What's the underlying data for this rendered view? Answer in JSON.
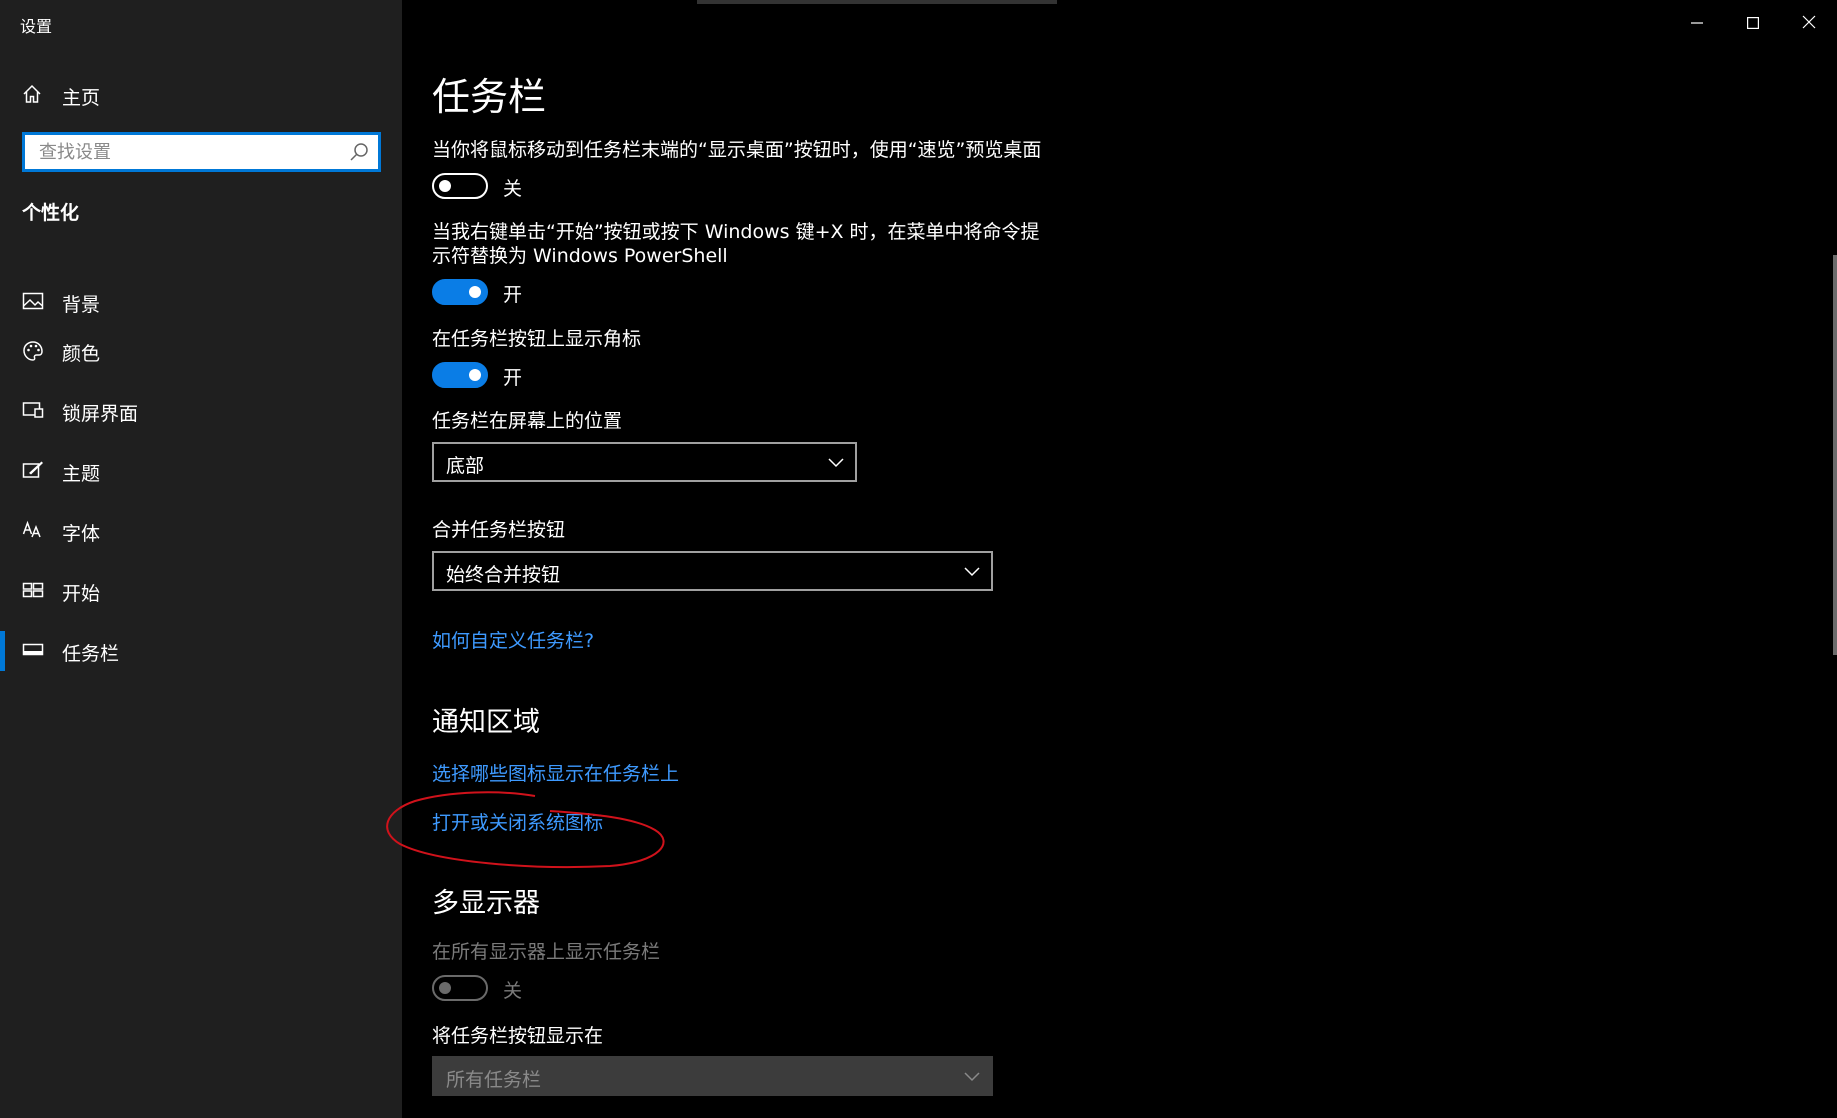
{
  "window": {
    "title": "设置"
  },
  "sidebar": {
    "home_label": "主页",
    "search_placeholder": "查找设置",
    "section_title": "个性化",
    "items": [
      {
        "label": "背景",
        "icon": "picture-icon"
      },
      {
        "label": "颜色",
        "icon": "palette-icon"
      },
      {
        "label": "锁屏界面",
        "icon": "lock-screen-icon"
      },
      {
        "label": "主题",
        "icon": "theme-icon"
      },
      {
        "label": "字体",
        "icon": "font-icon"
      },
      {
        "label": "开始",
        "icon": "start-icon"
      },
      {
        "label": "任务栏",
        "icon": "taskbar-icon",
        "selected": true
      }
    ]
  },
  "main": {
    "title": "任务栏",
    "peek": {
      "label": "当你将鼠标移动到任务栏末端的“显示桌面”按钮时，使用“速览”预览桌面",
      "state": "关",
      "on": false
    },
    "powershell": {
      "label_line1": "当我右键单击“开始”按钮或按下 Windows 键+X 时，在菜单中将命令提",
      "label_line2": "示符替换为 Windows PowerShell",
      "state": "开",
      "on": true
    },
    "badges": {
      "label": "在任务栏按钮上显示角标",
      "state": "开",
      "on": true
    },
    "location": {
      "label": "任务栏在屏幕上的位置",
      "value": "底部"
    },
    "combine": {
      "label": "合并任务栏按钮",
      "value": "始终合并按钮"
    },
    "help_link": "如何自定义任务栏?",
    "notification": {
      "heading": "通知区域",
      "link_icons": "选择哪些图标显示在任务栏上",
      "link_system_icons": "打开或关闭系统图标"
    },
    "multi_display": {
      "heading": "多显示器",
      "show_all_label": "在所有显示器上显示任务栏",
      "show_all_state": "关",
      "show_all_on": false,
      "buttons_label": "将任务栏按钮显示在",
      "buttons_value": "所有任务栏"
    }
  },
  "colors": {
    "accent": "#0078d7",
    "link": "#3e9aff",
    "annotation": "#d0121b",
    "sidebar_bg": "#1f1f1f",
    "main_bg": "#000000"
  }
}
